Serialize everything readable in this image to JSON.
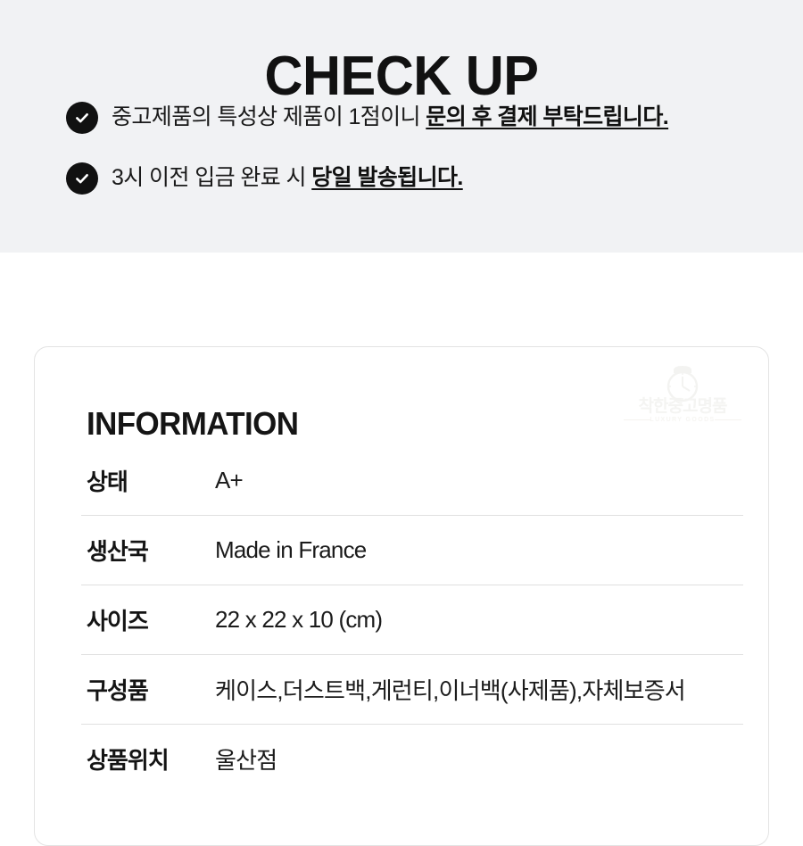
{
  "checkup": {
    "title": "CHECK UP",
    "items": [
      {
        "icon": "check-circle-icon",
        "text_plain": "중고제품의 특성상 제품이 1점이니 ",
        "text_emphasis": "문의 후 결제 부탁드립니다."
      },
      {
        "icon": "check-circle-icon",
        "text_plain": "3시 이전 입금 완료 시 ",
        "text_emphasis": "당일 발송됩니다."
      }
    ]
  },
  "information": {
    "heading": "INFORMATION",
    "watermark": {
      "icon": "watch-clock-icon",
      "brand": "착한중고명품",
      "tagline": "LUXURY GOODS"
    },
    "rows": [
      {
        "label": "상태",
        "value": "A+"
      },
      {
        "label": "생산국",
        "value": "Made in France"
      },
      {
        "label": "사이즈",
        "value": "22 x 22 x 10 (cm)"
      },
      {
        "label": "구성품",
        "value": "케이스,더스트백,게런티,이너백(사제품),자체보증서"
      },
      {
        "label": "상품위치",
        "value": "울산점"
      }
    ]
  },
  "colors": {
    "banner_bg": "#f1f2f4",
    "page_bg": "#ffffff",
    "text": "#111111",
    "icon_bg": "#111111",
    "icon_fg": "#ffffff",
    "card_border": "#e3e3e3",
    "divider": "#e0e0e0",
    "watermark": "#f4f4f2"
  }
}
